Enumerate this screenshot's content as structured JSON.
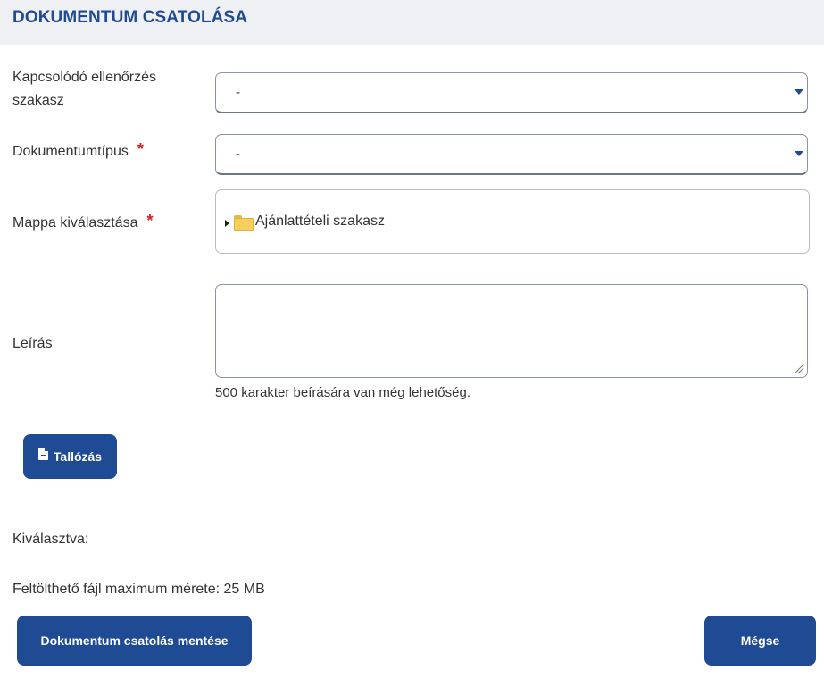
{
  "header": {
    "title": "DOKUMENTUM CSATOLÁSA"
  },
  "form": {
    "related_section": {
      "label_line1": "Kapcsolódó ellenőrzés",
      "label_line2": "szakasz",
      "value": "-"
    },
    "document_type": {
      "label": "Dokumentumtípus",
      "required_mark": "*",
      "value": "-"
    },
    "folder": {
      "label": "Mappa kiválasztása",
      "required_mark": "*",
      "tree_item": "Ajánlattételi szakasz"
    },
    "description": {
      "label": "Leírás",
      "value": "",
      "hint": "500 karakter beírására van még lehetőség."
    },
    "browse": {
      "label": "Tallózás",
      "icon": "file-icon"
    },
    "selected": {
      "label": "Kiválasztva:"
    },
    "max_size": {
      "text": "Feltölthető fájl maximum mérete: 25 MB"
    }
  },
  "actions": {
    "save_label": "Dokumentum csatolás mentése",
    "cancel_label": "Mégse"
  },
  "colors": {
    "accent": "#1f4a94",
    "required": "#d21f1f",
    "header_bg": "#eff0f3"
  }
}
